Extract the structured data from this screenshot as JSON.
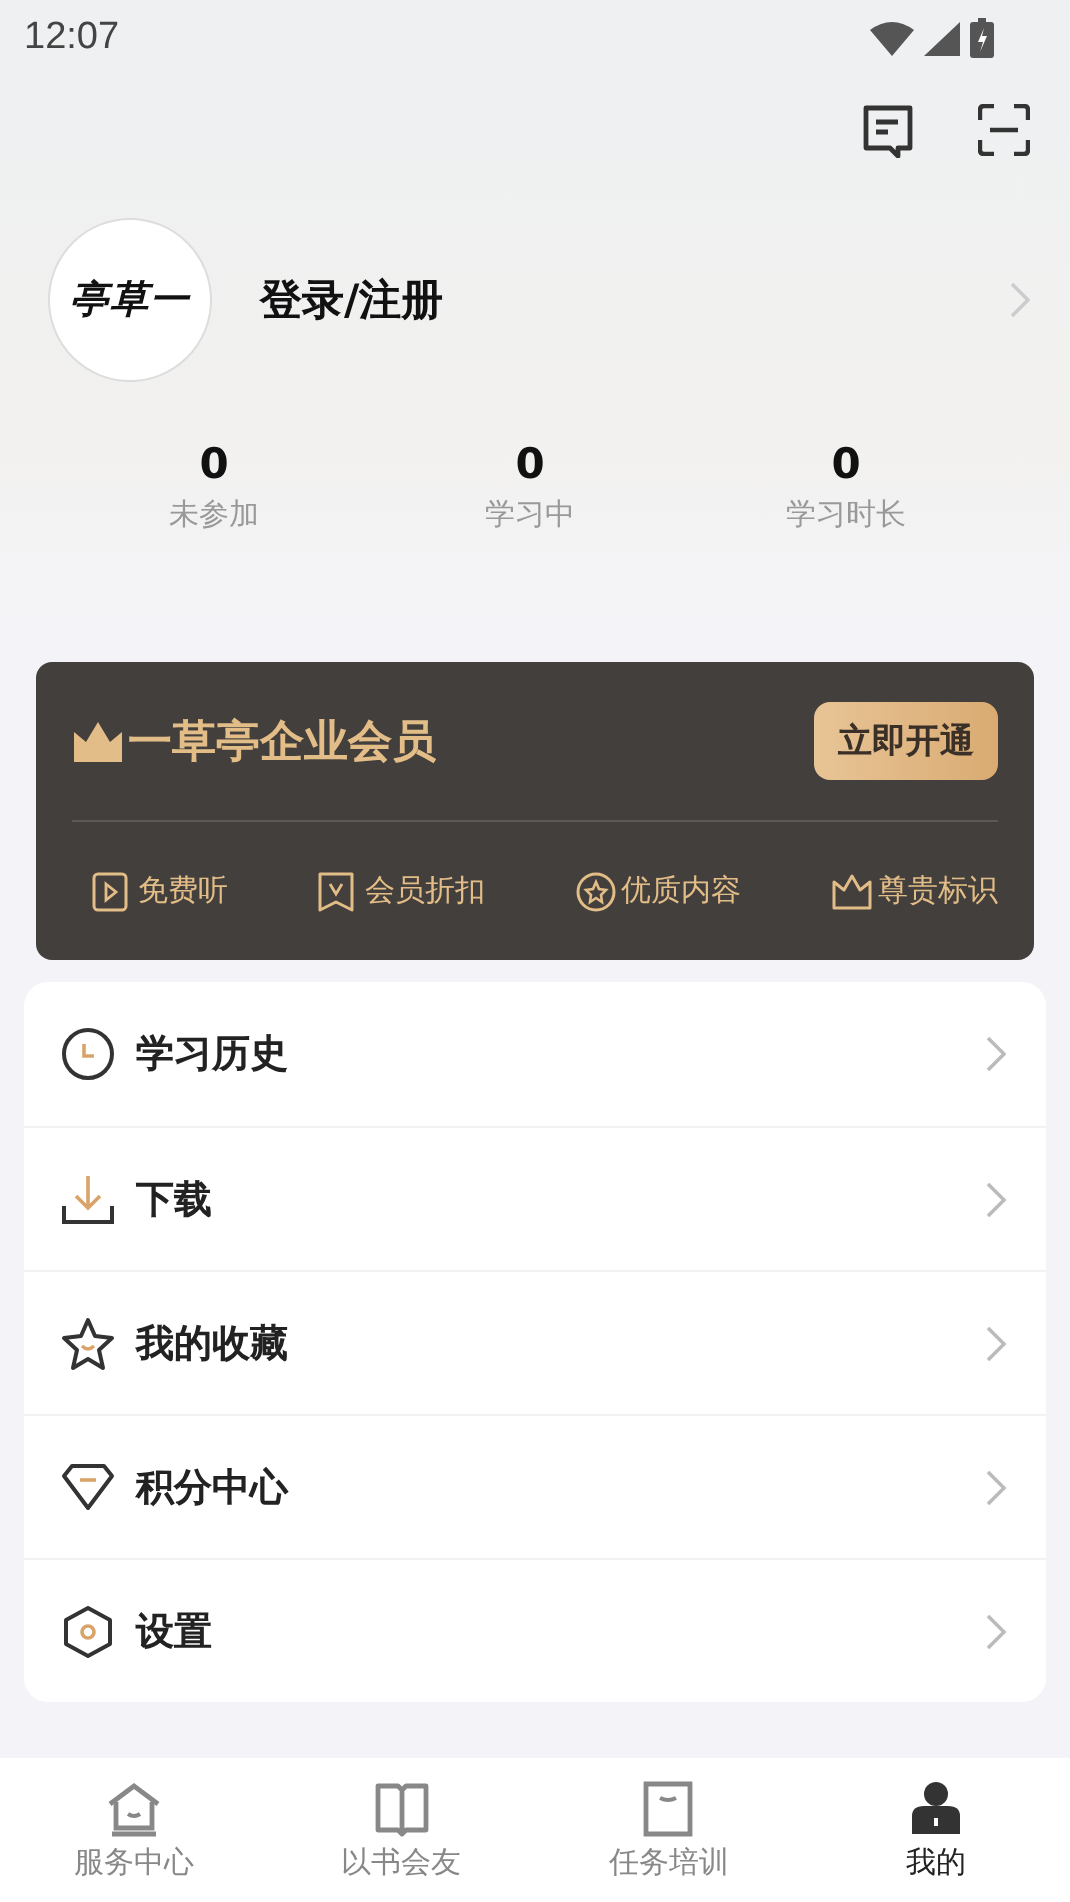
{
  "status_bar": {
    "time": "12:07"
  },
  "profile": {
    "avatar_text": "亭草一",
    "login": "登录/注册"
  },
  "stats": [
    {
      "value": "0",
      "label": "未参加"
    },
    {
      "value": "0",
      "label": "学习中"
    },
    {
      "value": "0",
      "label": "学习时长"
    }
  ],
  "membership": {
    "title": "一草亭企业会员",
    "button": "立即开通",
    "benefits": [
      "免费听",
      "会员折扣",
      "优质内容",
      "尊贵标识"
    ]
  },
  "menu": [
    {
      "label": "学习历史"
    },
    {
      "label": "下载"
    },
    {
      "label": "我的收藏"
    },
    {
      "label": "积分中心"
    },
    {
      "label": "设置"
    }
  ],
  "tabs": [
    {
      "label": "服务中心",
      "selected": false
    },
    {
      "label": "以书会友",
      "selected": false
    },
    {
      "label": "任务培训",
      "selected": false
    },
    {
      "label": "我的",
      "selected": true
    }
  ]
}
